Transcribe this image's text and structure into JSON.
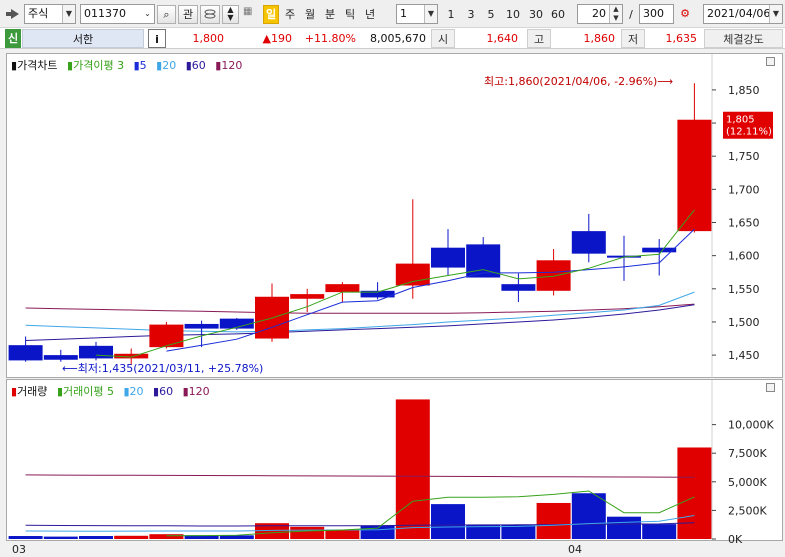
{
  "toolbar": {
    "market": "주식",
    "code": "011370",
    "btn_search": "⌕",
    "btn_relation": "관",
    "periods": [
      "일",
      "주",
      "월",
      "분",
      "틱",
      "년"
    ],
    "period_selected": 0,
    "interval_value": "1",
    "quick_intervals": [
      "1",
      "3",
      "5",
      "10",
      "30",
      "60"
    ],
    "count_value": "20",
    "count_sep": "/",
    "count_total": "300",
    "date_value": "2021/04/06"
  },
  "quote": {
    "badge": "신",
    "name": "서한",
    "info_icon": "i",
    "price": "1,800",
    "change": "▲190",
    "change_pct": "+11.80%",
    "volume": "8,005,670",
    "open_label": "시",
    "open": "1,640",
    "high_label": "고",
    "high": "1,860",
    "low_label": "저",
    "low": "1,635",
    "strength_label": "체결강도"
  },
  "colors": {
    "up": "#e00000",
    "down": "#0b15c8",
    "ma3": "#37a21a",
    "ma5": "#1a2dd8",
    "ma20": "#3fa6e8",
    "ma60": "#2c1a9a",
    "ma120": "#8a1a57"
  },
  "price_panel": {
    "legend": [
      {
        "label": "가격차트",
        "color": "#000"
      },
      {
        "label": "가격이평 3",
        "color": "#37a21a"
      },
      {
        "label": "5",
        "color": "#1a2dd8"
      },
      {
        "label": "20",
        "color": "#3fa6e8"
      },
      {
        "label": "60",
        "color": "#2c1a9a"
      },
      {
        "label": "120",
        "color": "#8a1a57"
      }
    ],
    "y_ticks": [
      "1,850",
      "1,800",
      "1,750",
      "1,700",
      "1,650",
      "1,600",
      "1,550",
      "1,500",
      "1,450"
    ],
    "max_note": "최고:1,860(2021/04/06, -2.96%)⟶",
    "min_note": "⟵최저:1,435(2021/03/11, +25.78%)",
    "last_tag_price": "1,805",
    "last_tag_pct": "(12.11%)"
  },
  "volume_panel": {
    "legend": [
      {
        "label": "거래량",
        "color": "#000"
      },
      {
        "label": "거래이평 5",
        "color": "#37a21a"
      },
      {
        "label": "20",
        "color": "#3fa6e8"
      },
      {
        "label": "60",
        "color": "#2c1a9a"
      },
      {
        "label": "120",
        "color": "#8a1a57"
      }
    ],
    "y_ticks": [
      "10,000K",
      "7,500K",
      "5,000K",
      "2,500K",
      "0K"
    ]
  },
  "x_labels": [
    "03",
    "04"
  ],
  "chart_data": {
    "type": "candlestick",
    "ylim_price": [
      1420,
      1880
    ],
    "ylim_volume": [
      0,
      12500
    ],
    "candles": [
      {
        "o": 1465,
        "h": 1478,
        "l": 1440,
        "c": 1442
      },
      {
        "o": 1450,
        "h": 1458,
        "l": 1440,
        "c": 1443
      },
      {
        "o": 1464,
        "h": 1470,
        "l": 1442,
        "c": 1445
      },
      {
        "o": 1445,
        "h": 1460,
        "l": 1435,
        "c": 1452
      },
      {
        "o": 1462,
        "h": 1500,
        "l": 1460,
        "c": 1496
      },
      {
        "o": 1497,
        "h": 1502,
        "l": 1462,
        "c": 1490
      },
      {
        "o": 1505,
        "h": 1506,
        "l": 1488,
        "c": 1490
      },
      {
        "o": 1475,
        "h": 1558,
        "l": 1470,
        "c": 1538
      },
      {
        "o": 1535,
        "h": 1550,
        "l": 1515,
        "c": 1542
      },
      {
        "o": 1545,
        "h": 1560,
        "l": 1530,
        "c": 1557
      },
      {
        "o": 1547,
        "h": 1560,
        "l": 1534,
        "c": 1537
      },
      {
        "o": 1555,
        "h": 1685,
        "l": 1535,
        "c": 1588
      },
      {
        "o": 1612,
        "h": 1640,
        "l": 1570,
        "c": 1582
      },
      {
        "o": 1617,
        "h": 1628,
        "l": 1570,
        "c": 1567
      },
      {
        "o": 1557,
        "h": 1573,
        "l": 1530,
        "c": 1547
      },
      {
        "o": 1547,
        "h": 1610,
        "l": 1540,
        "c": 1593
      },
      {
        "o": 1637,
        "h": 1663,
        "l": 1590,
        "c": 1603
      },
      {
        "o": 1600,
        "h": 1630,
        "l": 1562,
        "c": 1597
      },
      {
        "o": 1612,
        "h": 1625,
        "l": 1570,
        "c": 1605
      },
      {
        "o": 1637,
        "h": 1860,
        "l": 1635,
        "c": 1805
      }
    ],
    "volumes": [
      260,
      210,
      260,
      280,
      420,
      330,
      320,
      1380,
      1060,
      820,
      1170,
      12200,
      3050,
      1260,
      1240,
      3150,
      4000,
      1950,
      1300,
      8000
    ],
    "ma_price": {
      "ma3": [
        null,
        null,
        1450,
        1447,
        1464,
        1479,
        1492,
        1506,
        1523,
        1545,
        1545,
        1561,
        1570,
        1579,
        1565,
        1569,
        1581,
        1598,
        1602,
        1669
      ],
      "ma5": [
        null,
        null,
        null,
        null,
        1456,
        1465,
        1474,
        1492,
        1511,
        1530,
        1532,
        1552,
        1562,
        1574,
        1574,
        1575,
        1579,
        1583,
        1589,
        1640
      ],
      "ma20": [
        1495,
        1493,
        1491,
        1489,
        1487,
        1486,
        1485,
        1486,
        1488,
        1490,
        1493,
        1496,
        1500,
        1503,
        1506,
        1510,
        1514,
        1518,
        1525,
        1545
      ],
      "ma60": [
        1472,
        1474,
        1476,
        1478,
        1480,
        1481,
        1482,
        1484,
        1486,
        1488,
        1490,
        1492,
        1494,
        1497,
        1500,
        1503,
        1507,
        1512,
        1518,
        1526
      ],
      "ma120": [
        1521,
        1520,
        1519,
        1518,
        1517,
        1516,
        1515,
        1514,
        1513,
        1513,
        1513,
        1513,
        1513,
        1514,
        1515,
        1516,
        1518,
        1520,
        1523,
        1527
      ]
    },
    "ma_volume": {
      "ma5": [
        null,
        null,
        null,
        null,
        290,
        300,
        320,
        550,
        700,
        790,
        950,
        3300,
        3650,
        3650,
        3700,
        3900,
        4200,
        2300,
        2300,
        3680
      ],
      "ma20": [
        700,
        690,
        680,
        690,
        700,
        700,
        700,
        750,
        780,
        790,
        800,
        1000,
        1050,
        1080,
        1100,
        1200,
        1350,
        1450,
        1550,
        2050
      ],
      "ma60": [
        1200,
        1180,
        1170,
        1160,
        1150,
        1140,
        1140,
        1150,
        1160,
        1160,
        1170,
        1200,
        1220,
        1230,
        1240,
        1260,
        1290,
        1300,
        1320,
        1420
      ],
      "ma120": [
        5600,
        5590,
        5580,
        5570,
        5560,
        5550,
        5540,
        5530,
        5520,
        5510,
        5500,
        5480,
        5470,
        5460,
        5450,
        5440,
        5430,
        5420,
        5410,
        5400
      ]
    }
  }
}
